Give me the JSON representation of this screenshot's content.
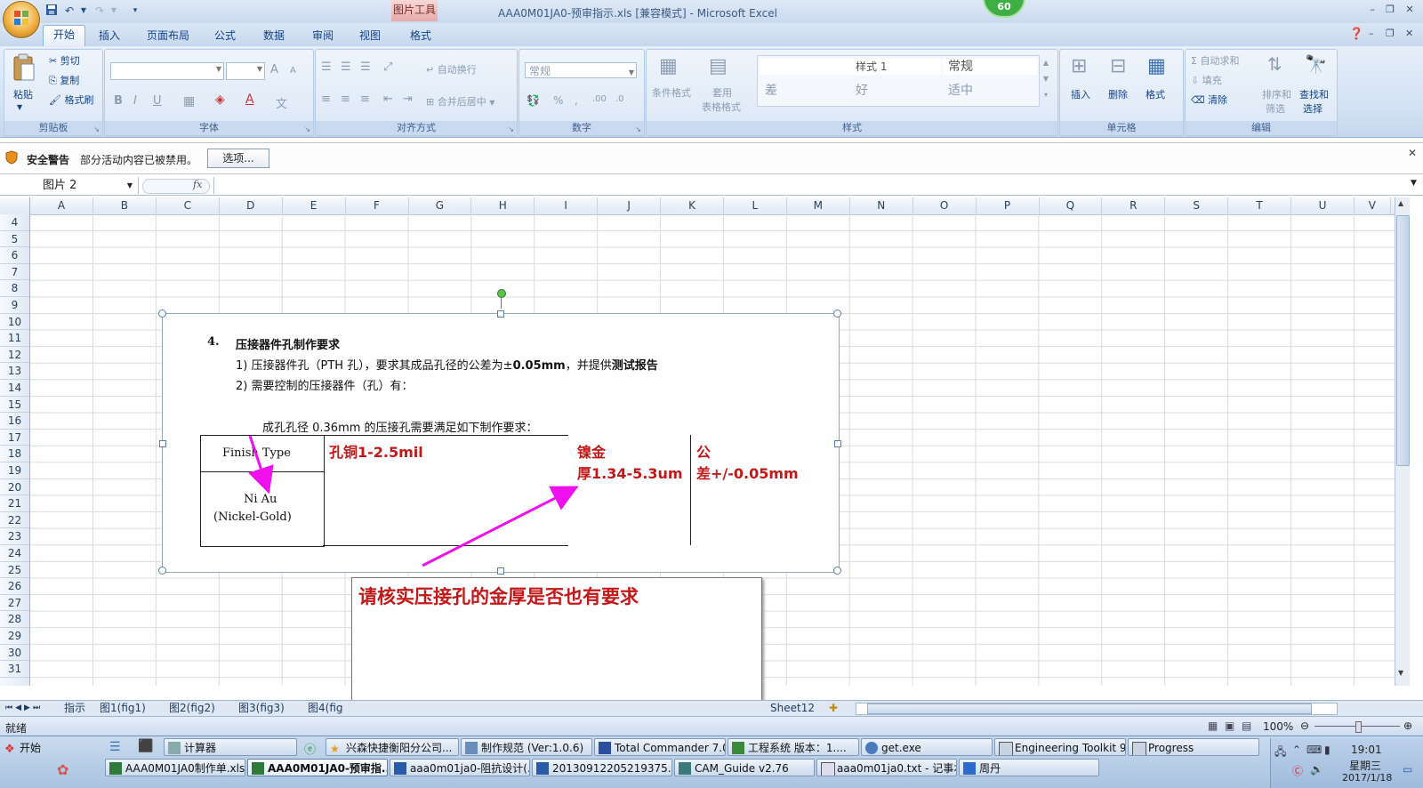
{
  "title_bar": {
    "title": "AAA0M01JA0-预审指示.xls  [兼容模式] - Microsoft Excel",
    "contextual_tab_group": "图片工具",
    "badge": "60"
  },
  "ribbon_tabs": [
    "开始",
    "插入",
    "页面布局",
    "公式",
    "数据",
    "审阅",
    "视图",
    "格式"
  ],
  "ribbon": {
    "clipboard": {
      "paste": "粘贴",
      "cut": "剪切",
      "copy": "复制",
      "format_painter": "格式刷",
      "label": "剪贴板"
    },
    "font": {
      "label": "字体",
      "bold": "B",
      "italic": "I",
      "underline": "U",
      "grow": "A",
      "shrink": "A"
    },
    "alignment": {
      "wrap": "自动换行",
      "merge": "合并后居中",
      "label": "对齐方式"
    },
    "number": {
      "format": "常规",
      "label": "数字"
    },
    "styles": {
      "conditional": "条件格式",
      "table_format_1": "套用",
      "table_format_2": "表格格式",
      "style1": "样式 1",
      "normal": "常规",
      "bad": "差",
      "good": "好",
      "neutral": "适中",
      "label": "样式"
    },
    "cells": {
      "insert": "插入",
      "delete": "删除",
      "format": "格式",
      "label": "单元格"
    },
    "editing": {
      "autosum": "自动求和",
      "fill": "填充",
      "clear": "清除",
      "sort_1": "排序和",
      "sort_2": "筛选",
      "find_1": "查找和",
      "find_2": "选择",
      "label": "编辑"
    }
  },
  "security_bar": {
    "title": "安全警告",
    "message": "部分活动内容已被禁用。",
    "options": "选项..."
  },
  "formula_bar": {
    "name_box": "图片 2",
    "fx": "fx"
  },
  "columns": [
    "A",
    "B",
    "C",
    "D",
    "E",
    "F",
    "G",
    "H",
    "I",
    "J",
    "K",
    "L",
    "M",
    "N",
    "O",
    "P",
    "Q",
    "R",
    "S",
    "T",
    "U",
    "V"
  ],
  "rows": [
    "4",
    "5",
    "6",
    "7",
    "8",
    "9",
    "10",
    "11",
    "12",
    "13",
    "14",
    "15",
    "16",
    "17",
    "18",
    "19",
    "20",
    "21",
    "22",
    "23",
    "24",
    "25",
    "26",
    "27",
    "28",
    "29",
    "30",
    "31"
  ],
  "picture": {
    "heading_num": "4.",
    "heading": "压接器件孔制作要求",
    "item1": "1)  压接器件孔（PTH 孔），要求其成品孔径的公差为±",
    "item1_bold": "0.05mm",
    "item1_tail": "，并提供",
    "item1_report": "测试报告",
    "item2": "2)  需要控制的压接器件（孔）有：",
    "subline": "成孔孔径 0.36mm 的压接孔需要满足如下制作要求：",
    "table": {
      "finish_type": "Finish Type",
      "niau": "Ni Au",
      "nickel_gold": "(Nickel-Gold)",
      "copper_req": "孔铜1-2.5mil",
      "ni_gold_1": "镍金",
      "ni_gold_2": "厚1.34-5.3um",
      "tol_1": "公",
      "tol_2": "差+/-0.05mm"
    }
  },
  "comment": "请核实压接孔的金厚是否也有要求",
  "sheet_tabs": [
    "指示",
    "图1(fig1)",
    "图2(fig2)",
    "图3(fig3)",
    "图4(fig",
    "Sheet12"
  ],
  "status_bar": {
    "ready": "就绪",
    "zoom": "100%"
  },
  "taskbar": {
    "start": "开始",
    "row1": [
      "计算器",
      "兴森快捷衡阳分公司...",
      "制作规范 (Ver:1.0.6)",
      "Total Commander 7.0 ...",
      "工程系统  版本：1....",
      "get.exe",
      "Engineering Toolkit 9....",
      "Progress"
    ],
    "row2": [
      "AAA0M01JA0制作单.xls...",
      "AAA0M01JA0-预审指...",
      "aaa0m01ja0-阻抗设计(...",
      "20130912205219375.rtf...",
      "CAM_Guide v2.76",
      "aaa0m01ja0.txt - 记事本",
      "周丹"
    ],
    "clock": "19:01",
    "weekday": "星期三",
    "date": "2017/1/18"
  },
  "colors": {
    "ribbon_blue": "#15428b",
    "annotation_red": "#c21818",
    "arrow_magenta": "#ee11ee"
  }
}
